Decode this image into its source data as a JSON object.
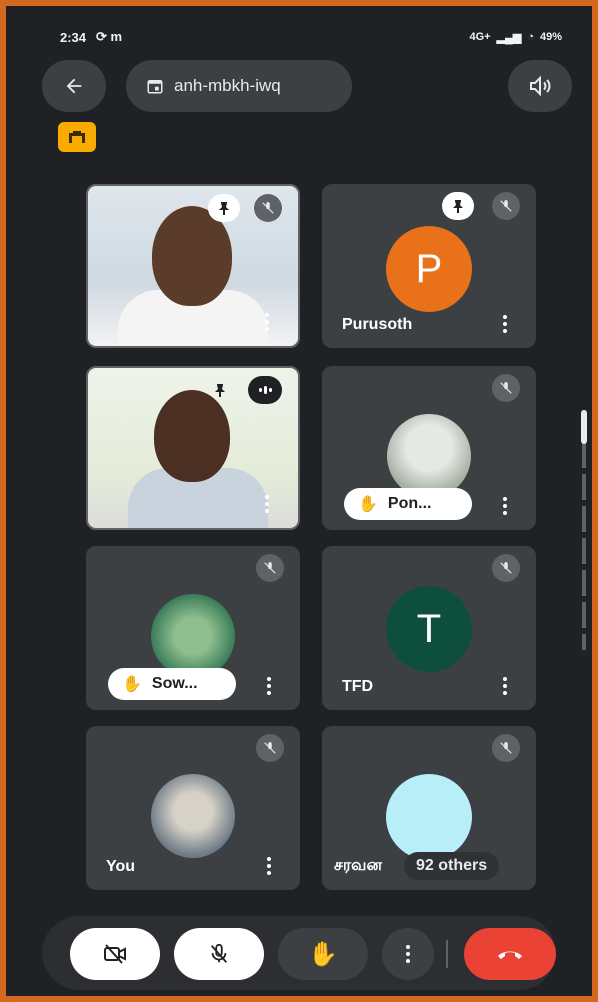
{
  "status_bar": {
    "time": "2:34",
    "network": "4G+",
    "battery": "49%"
  },
  "header": {
    "meeting_code": "anh-mbkh-iwq"
  },
  "tiles": [
    {
      "name": "",
      "type": "video",
      "pinned": true,
      "muted": true
    },
    {
      "name": "Purusoth",
      "avatar_letter": "P",
      "avatar_color": "#e8711a",
      "pinned": true,
      "muted": true
    },
    {
      "name": "",
      "type": "video",
      "pinned": true,
      "speaking": true
    },
    {
      "name": "Pon...",
      "hand_raised": true,
      "muted": true
    },
    {
      "name": "Sow...",
      "hand_raised": true,
      "muted": true
    },
    {
      "name": "TFD",
      "avatar_letter": "T",
      "avatar_color": "#0d4f3c",
      "muted": true
    },
    {
      "name": "You",
      "muted": true
    },
    {
      "name": "சரவன",
      "others_label": "92 others",
      "avatar_color": "#b8eef7",
      "muted": true
    }
  ],
  "icons": {
    "back": "arrow-left-icon",
    "calendar": "calendar-icon",
    "speaker": "speaker-icon",
    "camera_off": "camera-off-icon",
    "mic_off": "mic-off-icon",
    "hand": "raise-hand-icon",
    "more": "more-vertical-icon",
    "end_call": "end-call-icon",
    "pin": "pin-icon"
  }
}
